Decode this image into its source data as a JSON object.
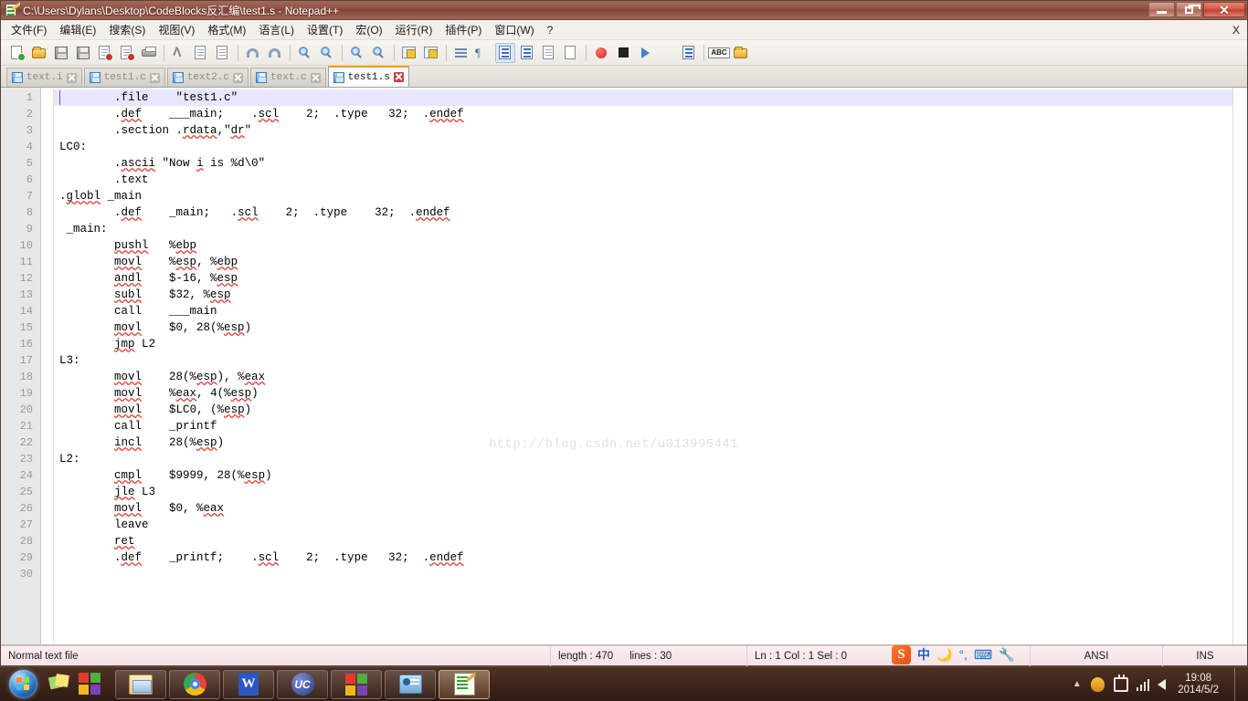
{
  "window": {
    "title": "C:\\Users\\Dylans\\Desktop\\CodeBlocks反汇编\\test1.s - Notepad++",
    "icon": "notepad-plus-plus-icon",
    "buttons": {
      "minimize": "minimize",
      "restore": "restore",
      "close": "close"
    }
  },
  "menubar": {
    "items": [
      {
        "label": "文件(F)",
        "name": "menu-file"
      },
      {
        "label": "编辑(E)",
        "name": "menu-edit"
      },
      {
        "label": "搜索(S)",
        "name": "menu-search"
      },
      {
        "label": "视图(V)",
        "name": "menu-view"
      },
      {
        "label": "格式(M)",
        "name": "menu-format"
      },
      {
        "label": "语言(L)",
        "name": "menu-language"
      },
      {
        "label": "设置(T)",
        "name": "menu-settings"
      },
      {
        "label": "宏(O)",
        "name": "menu-macro"
      },
      {
        "label": "运行(R)",
        "name": "menu-run"
      },
      {
        "label": "插件(P)",
        "name": "menu-plugins"
      },
      {
        "label": "窗口(W)",
        "name": "menu-window"
      },
      {
        "label": "?",
        "name": "menu-help"
      }
    ],
    "close_doc": "X"
  },
  "toolbar": {
    "icons": [
      "new-file-icon",
      "open-file-icon",
      "save-icon",
      "save-all-icon",
      "close-file-icon",
      "close-all-icon",
      "print-icon",
      "sep",
      "cut-icon",
      "copy-icon",
      "paste-icon",
      "sep",
      "undo-icon",
      "redo-icon",
      "sep",
      "find-icon",
      "replace-icon",
      "sep",
      "zoom-in-icon",
      "zoom-out-icon",
      "sep",
      "sync-vertical-icon",
      "sync-horizontal-icon",
      "sep",
      "word-wrap-icon",
      "show-all-chars-icon",
      "indent-guide-icon",
      "user-defined-dialog-icon",
      "show-doc-map-icon",
      "function-list-icon",
      "sep",
      "record-macro-icon",
      "stop-macro-icon",
      "play-macro-icon",
      "fast-play-macro-icon",
      "save-macro-icon",
      "sep",
      "spell-check-icon",
      "run-icon"
    ]
  },
  "tabs": [
    {
      "label": "text.i",
      "name": "tab-text-i",
      "active": false,
      "modified": false
    },
    {
      "label": "test1.c",
      "name": "tab-test1-c",
      "active": false,
      "modified": false
    },
    {
      "label": "text2.c",
      "name": "tab-text2-c",
      "active": false,
      "modified": false
    },
    {
      "label": "text.c",
      "name": "tab-text-c",
      "active": false,
      "modified": false
    },
    {
      "label": "test1.s",
      "name": "tab-test1-s",
      "active": true,
      "modified": false
    }
  ],
  "editor": {
    "current_line": 1,
    "watermark": "http://blog.csdn.net/u013995441",
    "line_numbers": [
      1,
      2,
      3,
      4,
      5,
      6,
      7,
      8,
      9,
      10,
      11,
      12,
      13,
      14,
      15,
      16,
      17,
      18,
      19,
      20,
      21,
      22,
      23,
      24,
      25,
      26,
      27,
      28,
      29,
      30
    ],
    "lines": [
      "        .file    \"test1.c\"",
      "        .def    ___main;    .scl    2;  .type   32;  .endef",
      "        .section .rdata,\"dr\"",
      "LC0:",
      "        .ascii \"Now i is %d\\0\"",
      "        .text",
      ".globl _main",
      "        .def    _main;   .scl    2;  .type    32;  .endef",
      " _main:",
      "        pushl   %ebp",
      "        movl    %esp, %ebp",
      "        andl    $-16, %esp",
      "        subl    $32, %esp",
      "        call    ___main",
      "        movl    $0, 28(%esp)",
      "        jmp L2",
      "L3:",
      "        movl    28(%esp), %eax",
      "        movl    %eax, 4(%esp)",
      "        movl    $LC0, (%esp)",
      "        call    _printf",
      "        incl    28(%esp)",
      "L2:",
      "        cmpl    $9999, 28(%esp)",
      "        jle L3",
      "        movl    $0, %eax",
      "        leave",
      "        ret",
      "        .def    _printf;    .scl    2;  .type   32;  .endef",
      ""
    ]
  },
  "statusbar": {
    "doc_type": "Normal text file",
    "length_label": "length : 470",
    "lines_label": "lines : 30",
    "position": "Ln : 1    Col : 1    Sel : 0",
    "encoding": "ANSI",
    "insert_mode": "INS"
  },
  "ime": {
    "logo": "S",
    "mode": "中",
    "glyphs": [
      "moon-icon",
      "punctuation-icon",
      "soft-keyboard-icon",
      "toolbox-icon"
    ]
  },
  "taskbar": {
    "start": "start-orb",
    "quick_launch": [
      "sticky-notes-icon",
      "network-icon"
    ],
    "buttons": [
      {
        "name": "taskbar-explorer",
        "icon": "explorer-icon",
        "selected": false
      },
      {
        "name": "taskbar-chrome",
        "icon": "chrome-icon",
        "selected": false
      },
      {
        "name": "taskbar-wps",
        "icon": "wps-writer-icon",
        "selected": false
      },
      {
        "name": "taskbar-uc",
        "icon": "uc-browser-icon",
        "selected": false
      },
      {
        "name": "taskbar-windows",
        "icon": "windows-logo-icon",
        "selected": false
      },
      {
        "name": "taskbar-controlpanel",
        "icon": "control-panel-icon",
        "selected": false
      },
      {
        "name": "taskbar-notepadpp",
        "icon": "notepad-plus-plus-icon",
        "selected": true
      }
    ],
    "tray": {
      "show_hidden": "▲",
      "icons": [
        "qq-icon",
        "safely-remove-icon",
        "network-signal-icon",
        "volume-icon"
      ],
      "time": "19:08",
      "date": "2014/5/2"
    }
  }
}
